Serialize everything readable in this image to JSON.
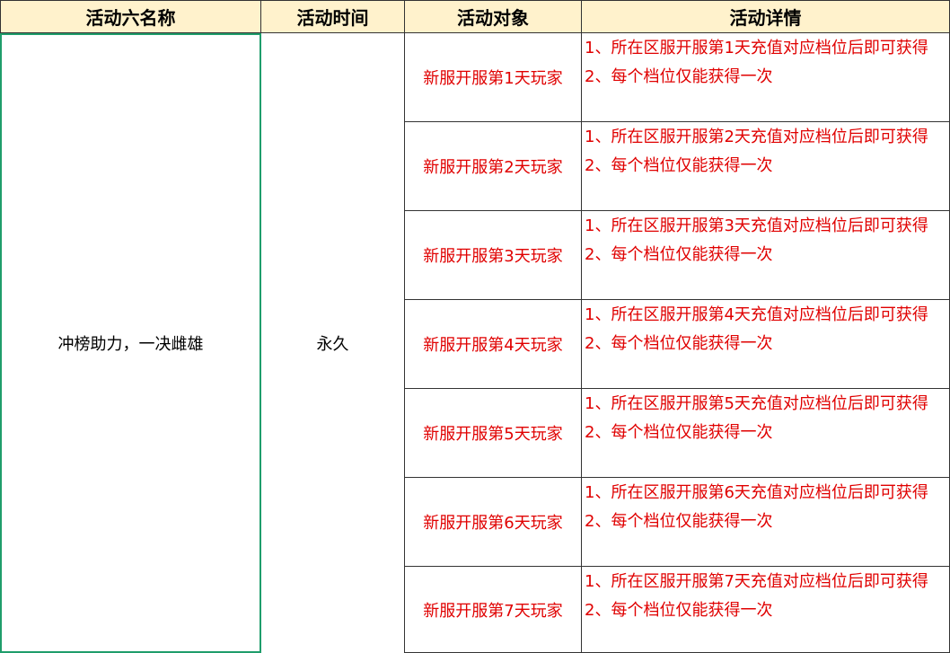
{
  "headers": {
    "name": "活动六名称",
    "time": "活动时间",
    "target": "活动对象",
    "detail": "活动详情"
  },
  "activity": {
    "name": "冲榜助力，一决雌雄",
    "time": "永久"
  },
  "rows": [
    {
      "target": "新服开服第1天玩家",
      "line1": "1、所在区服开服第1天充值对应档位后即可获得",
      "line2": "2、每个档位仅能获得一次"
    },
    {
      "target": "新服开服第2天玩家",
      "line1": "1、所在区服开服第2天充值对应档位后即可获得",
      "line2": "2、每个档位仅能获得一次"
    },
    {
      "target": "新服开服第3天玩家",
      "line1": "1、所在区服开服第3天充值对应档位后即可获得",
      "line2": "2、每个档位仅能获得一次"
    },
    {
      "target": "新服开服第4天玩家",
      "line1": "1、所在区服开服第4天充值对应档位后即可获得",
      "line2": "2、每个档位仅能获得一次"
    },
    {
      "target": "新服开服第5天玩家",
      "line1": "1、所在区服开服第5天充值对应档位后即可获得",
      "line2": "2、每个档位仅能获得一次"
    },
    {
      "target": "新服开服第6天玩家",
      "line1": "1、所在区服开服第6天充值对应档位后即可获得",
      "line2": "2、每个档位仅能获得一次"
    },
    {
      "target": "新服开服第7天玩家",
      "line1": "1、所在区服开服第7天充值对应档位后即可获得",
      "line2": "2、每个档位仅能获得一次"
    }
  ],
  "colors": {
    "header_bg": "#fff2cc",
    "detail_text": "#e00000",
    "selection_border": "#1f9d6b"
  }
}
